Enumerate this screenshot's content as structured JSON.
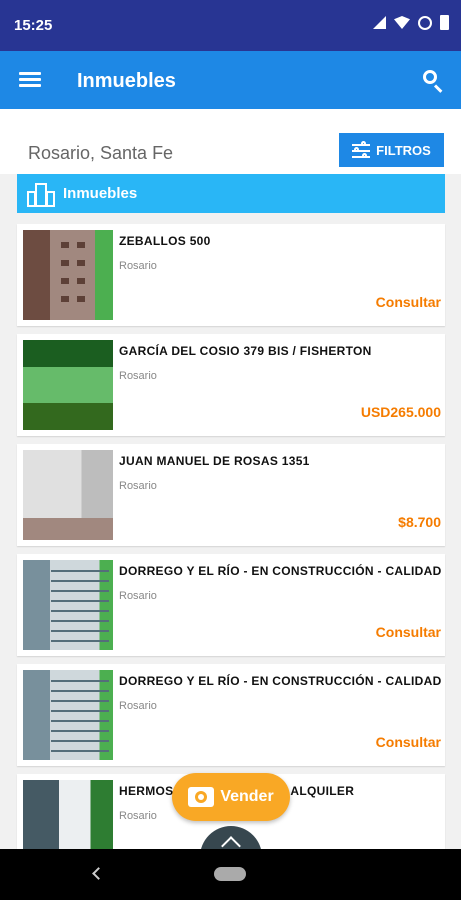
{
  "status_bar": {
    "time": "15:25"
  },
  "app_bar": {
    "title": "Inmuebles"
  },
  "location": "Rosario, Santa Fe",
  "filters_label": "FILTROS",
  "section_title": "Inmuebles",
  "listings": [
    {
      "title": "ZEBALLOS 500",
      "city": "Rosario",
      "price": "Consultar"
    },
    {
      "title": "GARCÍA DEL COSIO 379 BIS / FISHERTON",
      "city": "Rosario",
      "price": "USD265.000"
    },
    {
      "title": "JUAN MANUEL DE ROSAS 1351",
      "city": "Rosario",
      "price": "$8.700"
    },
    {
      "title": "DORREGO Y EL RÍO - EN CONSTRUCCIÓN - CALIDAD",
      "city": "Rosario",
      "price": "Consultar"
    },
    {
      "title": "DORREGO Y EL RÍO - EN CONSTRUCCIÓN - CALIDAD",
      "city": "Rosario",
      "price": "Consultar"
    },
    {
      "title": "HERMOSO ... CÉNTRICO EN ALQUILER",
      "city": "Rosario",
      "price": ""
    }
  ],
  "fab": {
    "label": "Vender"
  },
  "colors": {
    "status_bar": "#283593",
    "app_bar": "#1e88e5",
    "section": "#29b6f6",
    "price": "#f57c00",
    "fab": "#f9a825"
  }
}
